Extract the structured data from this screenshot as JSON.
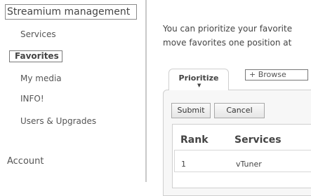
{
  "sidebar": {
    "title": "Streamium management",
    "items": [
      {
        "label": "Services"
      },
      {
        "label": "Favorites",
        "selected": true
      },
      {
        "label": "My media"
      },
      {
        "label": "INFO!"
      },
      {
        "label": "Users & Upgrades"
      }
    ],
    "account_label": "Account"
  },
  "main": {
    "intro_line1": "You can prioritize your favorite",
    "intro_line2": "move favorites one position at",
    "tabs": [
      {
        "label": "Prioritize",
        "active": true
      },
      {
        "label": "+ Browse"
      }
    ],
    "buttons": {
      "submit": "Submit",
      "cancel": "Cancel"
    },
    "table": {
      "columns": [
        "Rank",
        "Services"
      ],
      "rows": [
        {
          "rank": "1",
          "service": "vTuner"
        }
      ]
    }
  },
  "colors": {
    "background": "#ffffff",
    "panel": "#f7f7f7",
    "border": "#cfcfcf",
    "separator": "#c9c9c9"
  }
}
